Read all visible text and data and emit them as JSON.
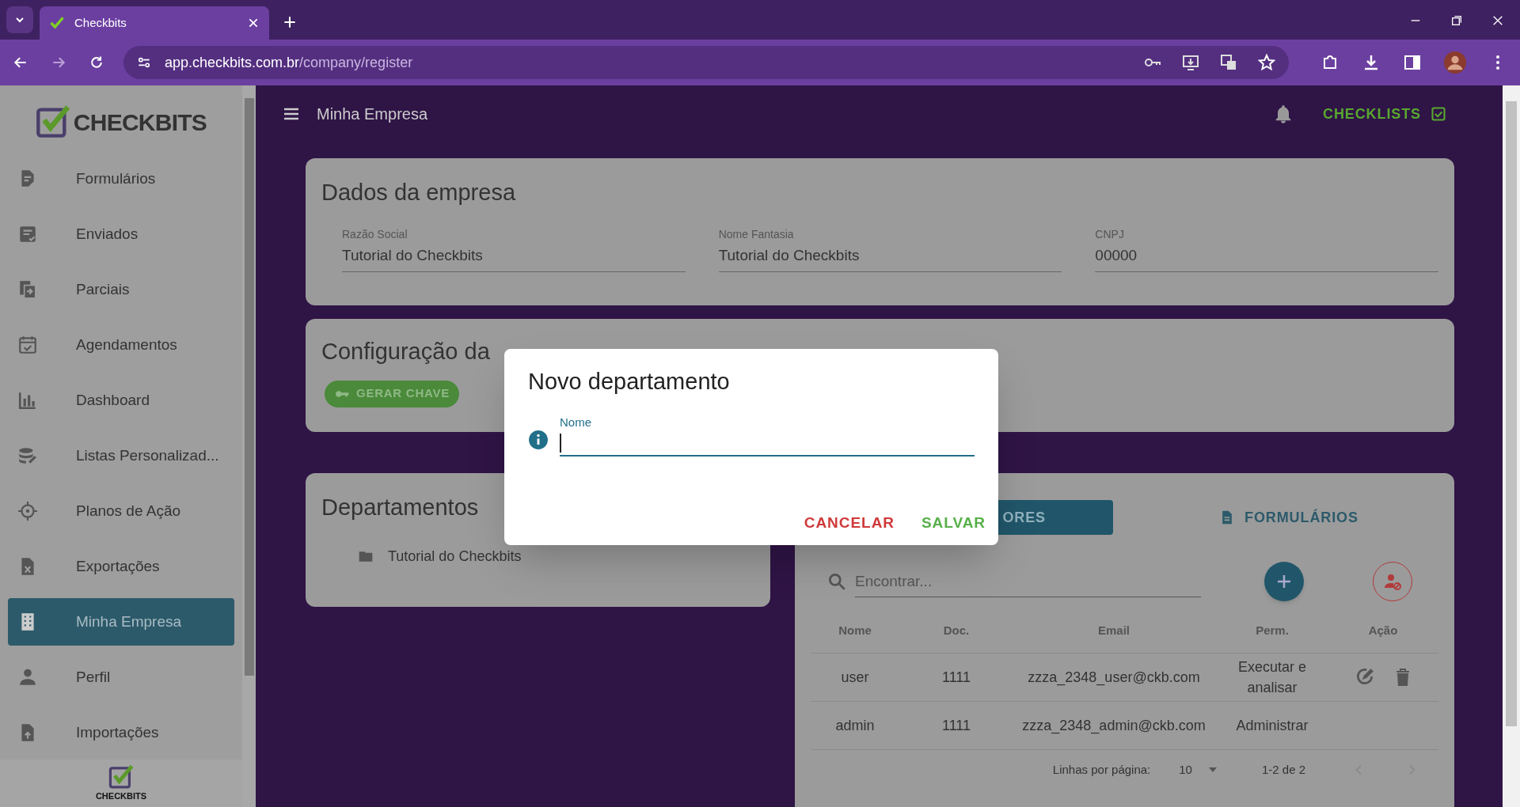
{
  "browser": {
    "tab_title": "Checkbits",
    "url_host": "app.checkbits.com.br",
    "url_path": "/company/register"
  },
  "sidebar": {
    "logo": "CHECKBITS",
    "footer_logo": "CHECKBITS",
    "items": [
      {
        "label": "Formulários",
        "selected": false
      },
      {
        "label": "Enviados",
        "selected": false
      },
      {
        "label": "Parciais",
        "selected": false
      },
      {
        "label": "Agendamentos",
        "selected": false
      },
      {
        "label": "Dashboard",
        "selected": false
      },
      {
        "label": "Listas Personalizad...",
        "selected": false
      },
      {
        "label": "Planos de Ação",
        "selected": false
      },
      {
        "label": "Exportações",
        "selected": false
      },
      {
        "label": "Minha Empresa",
        "selected": true
      },
      {
        "label": "Perfil",
        "selected": false
      },
      {
        "label": "Importações",
        "selected": false
      }
    ]
  },
  "header": {
    "title": "Minha Empresa",
    "action": "CHECKLISTS"
  },
  "company_card": {
    "title": "Dados da empresa",
    "fields": [
      {
        "label": "Razão Social",
        "value": "Tutorial do Checkbits"
      },
      {
        "label": "Nome Fantasia",
        "value": "Tutorial do Checkbits"
      },
      {
        "label": "CNPJ",
        "value": "00000"
      }
    ]
  },
  "api_card": {
    "title": "Configuração da",
    "button": "GERAR CHAVE"
  },
  "departments_card": {
    "title": "Departamentos",
    "tree": [
      {
        "label": "Tutorial do Checkbits"
      }
    ]
  },
  "users_panel": {
    "tabs": [
      {
        "label": "ORES",
        "selected": true
      },
      {
        "label": "FORMULÁRIOS",
        "selected": false
      }
    ],
    "search": {
      "placeholder": "Encontrar..."
    },
    "columns": [
      "Nome",
      "Doc.",
      "Email",
      "Perm.",
      "Ação"
    ],
    "rows": [
      {
        "cells": [
          "user",
          "1111",
          "zzza_2348_user@ckb.com",
          "Executar e analisar"
        ],
        "has_actions": true
      },
      {
        "cells": [
          "admin",
          "1111",
          "zzza_2348_admin@ckb.com",
          "Administrar"
        ],
        "has_actions": false
      }
    ],
    "pagination": {
      "label": "Linhas por página:",
      "rows_per_page": "10",
      "range": "1-2 de 2"
    }
  },
  "dialog": {
    "title": "Novo departamento",
    "field": {
      "label": "Nome",
      "focused": true
    },
    "buttons": [
      {
        "label": "CANCELAR",
        "kind": "cancel"
      },
      {
        "label": "SALVAR",
        "kind": "save"
      }
    ]
  }
}
